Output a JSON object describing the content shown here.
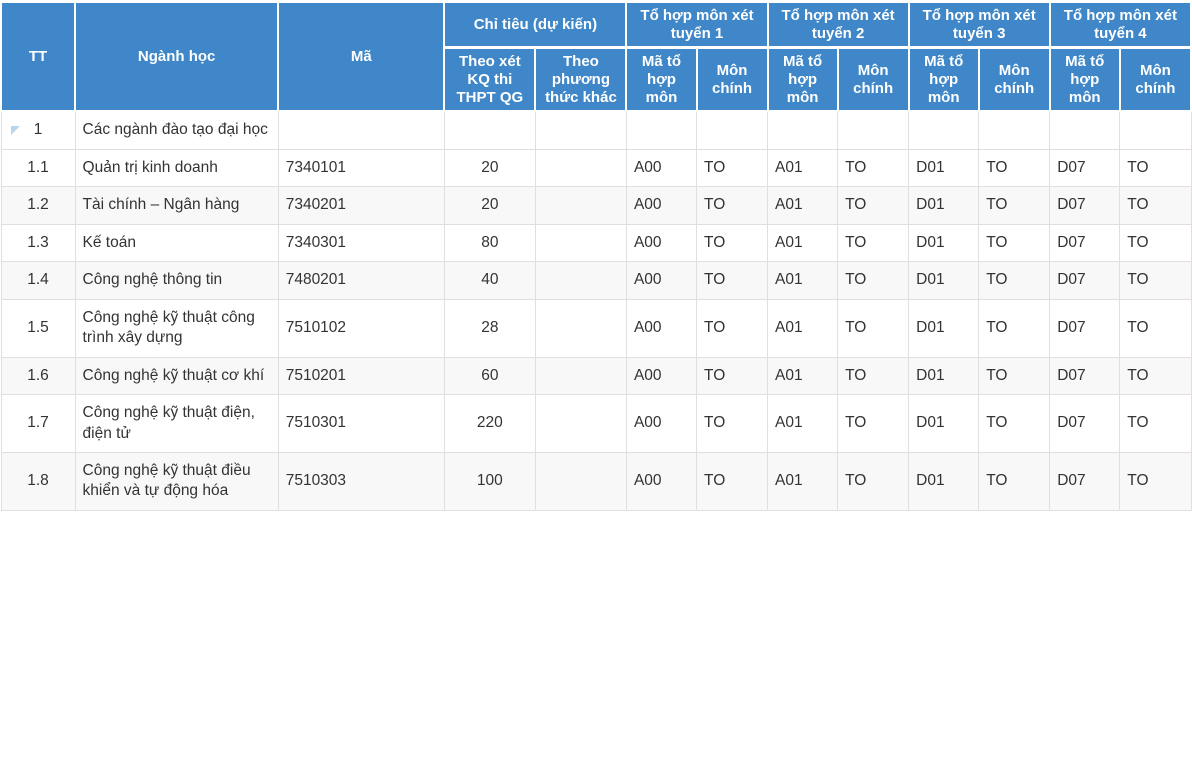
{
  "table": {
    "headers": {
      "tt": "TT",
      "nganh_hoc": "Ngành học",
      "ma": "Mã",
      "chi_tieu_group": "Chỉ tiêu (dự kiến)",
      "theo_xet_kq": "Theo xét KQ thi THPT QG",
      "theo_phuong_thuc_khac": "Theo phương thức khác",
      "to_hop_1": "Tổ hợp môn xét tuyển 1",
      "to_hop_2": "Tổ hợp môn xét tuyển 2",
      "to_hop_3": "Tổ hợp môn xét tuyển 3",
      "to_hop_4": "Tổ hợp môn xét tuyển 4",
      "ma_to_hop_mon": "Mã tổ hợp môn",
      "mon_chinh": "Môn chính"
    },
    "rows": [
      {
        "tt": "1",
        "nganh_hoc": "Các ngành đào tạo đại học",
        "ma": "",
        "quota_thpt": "",
        "quota_other": "",
        "c1_code": "",
        "c1_main": "",
        "c2_code": "",
        "c2_main": "",
        "c3_code": "",
        "c3_main": "",
        "c4_code": "",
        "c4_main": "",
        "is_group": true,
        "shaded": false
      },
      {
        "tt": "1.1",
        "nganh_hoc": "Quản trị kinh doanh",
        "ma": "7340101",
        "quota_thpt": "20",
        "quota_other": "",
        "c1_code": "A00",
        "c1_main": "TO",
        "c2_code": "A01",
        "c2_main": "TO",
        "c3_code": "D01",
        "c3_main": "TO",
        "c4_code": "D07",
        "c4_main": "TO",
        "is_group": false,
        "shaded": false
      },
      {
        "tt": "1.2",
        "nganh_hoc": "Tài chính – Ngân hàng",
        "ma": "7340201",
        "quota_thpt": "20",
        "quota_other": "",
        "c1_code": "A00",
        "c1_main": "TO",
        "c2_code": "A01",
        "c2_main": "TO",
        "c3_code": "D01",
        "c3_main": "TO",
        "c4_code": "D07",
        "c4_main": "TO",
        "is_group": false,
        "shaded": true
      },
      {
        "tt": "1.3",
        "nganh_hoc": "Kế toán",
        "ma": "7340301",
        "quota_thpt": "80",
        "quota_other": "",
        "c1_code": "A00",
        "c1_main": "TO",
        "c2_code": "A01",
        "c2_main": "TO",
        "c3_code": "D01",
        "c3_main": "TO",
        "c4_code": "D07",
        "c4_main": "TO",
        "is_group": false,
        "shaded": false
      },
      {
        "tt": "1.4",
        "nganh_hoc": "Công nghệ thông tin",
        "ma": "7480201",
        "quota_thpt": "40",
        "quota_other": "",
        "c1_code": "A00",
        "c1_main": "TO",
        "c2_code": "A01",
        "c2_main": "TO",
        "c3_code": "D01",
        "c3_main": "TO",
        "c4_code": "D07",
        "c4_main": "TO",
        "is_group": false,
        "shaded": true
      },
      {
        "tt": "1.5",
        "nganh_hoc": "Công nghệ kỹ thuật công trình xây dựng",
        "ma": "7510102",
        "quota_thpt": "28",
        "quota_other": "",
        "c1_code": "A00",
        "c1_main": "TO",
        "c2_code": "A01",
        "c2_main": "TO",
        "c3_code": "D01",
        "c3_main": "TO",
        "c4_code": "D07",
        "c4_main": "TO",
        "is_group": false,
        "shaded": false
      },
      {
        "tt": "1.6",
        "nganh_hoc": "Công nghệ kỹ thuật cơ khí",
        "ma": "7510201",
        "quota_thpt": "60",
        "quota_other": "",
        "c1_code": "A00",
        "c1_main": "TO",
        "c2_code": "A01",
        "c2_main": "TO",
        "c3_code": "D01",
        "c3_main": "TO",
        "c4_code": "D07",
        "c4_main": "TO",
        "is_group": false,
        "shaded": true
      },
      {
        "tt": "1.7",
        "nganh_hoc": "Công nghệ kỹ thuật điện, điện tử",
        "ma": "7510301",
        "quota_thpt": "220",
        "quota_other": "",
        "c1_code": "A00",
        "c1_main": "TO",
        "c2_code": "A01",
        "c2_main": "TO",
        "c3_code": "D01",
        "c3_main": "TO",
        "c4_code": "D07",
        "c4_main": "TO",
        "is_group": false,
        "shaded": false
      },
      {
        "tt": "1.8",
        "nganh_hoc": "Công nghệ kỹ thuật điều khiển và tự động hóa",
        "ma": "7510303",
        "quota_thpt": "100",
        "quota_other": "",
        "c1_code": "A00",
        "c1_main": "TO",
        "c2_code": "A01",
        "c2_main": "TO",
        "c3_code": "D01",
        "c3_main": "TO",
        "c4_code": "D07",
        "c4_main": "TO",
        "is_group": false,
        "shaded": true
      }
    ]
  },
  "colors": {
    "header_bg": "#3f87c8",
    "header_text": "#ffffff",
    "row_shade": "#f8f8f8",
    "row_plain": "#ffffff",
    "cell_border": "#e0dede",
    "body_text": "#333333",
    "marker": "#b9d6ec"
  },
  "icons": {
    "collapse_marker": "triangle-collapse-icon"
  }
}
